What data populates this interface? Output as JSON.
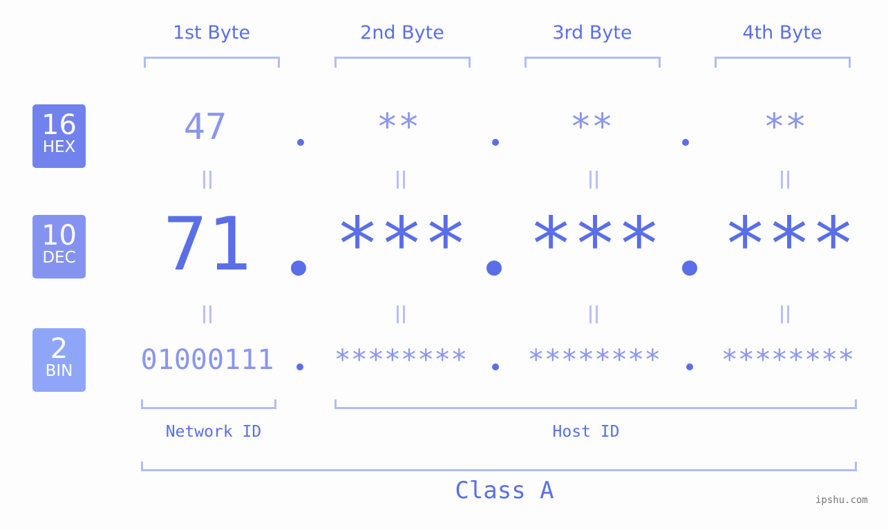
{
  "bytes": [
    {
      "label": "1st Byte",
      "hex": "47",
      "dec": "71",
      "bin": "01000111"
    },
    {
      "label": "2nd Byte",
      "hex": "**",
      "dec": "***",
      "bin": "********"
    },
    {
      "label": "3rd Byte",
      "hex": "**",
      "dec": "***",
      "bin": "********"
    },
    {
      "label": "4th Byte",
      "hex": "**",
      "dec": "***",
      "bin": "********"
    }
  ],
  "bases": {
    "hex": {
      "number": "16",
      "label": "HEX",
      "color": "#7282ec"
    },
    "dec": {
      "number": "10",
      "label": "DEC",
      "color": "#8593f0"
    },
    "bin": {
      "number": "2",
      "label": "BIN",
      "color": "#8fa6f8"
    }
  },
  "parts": {
    "network": "Network ID",
    "host": "Host ID",
    "class": "Class A"
  },
  "watermark": "ipshu.com",
  "colors": {
    "accent": "#5a6ee8",
    "light": "#8a95ee",
    "bracket": "#b1bcf6"
  }
}
